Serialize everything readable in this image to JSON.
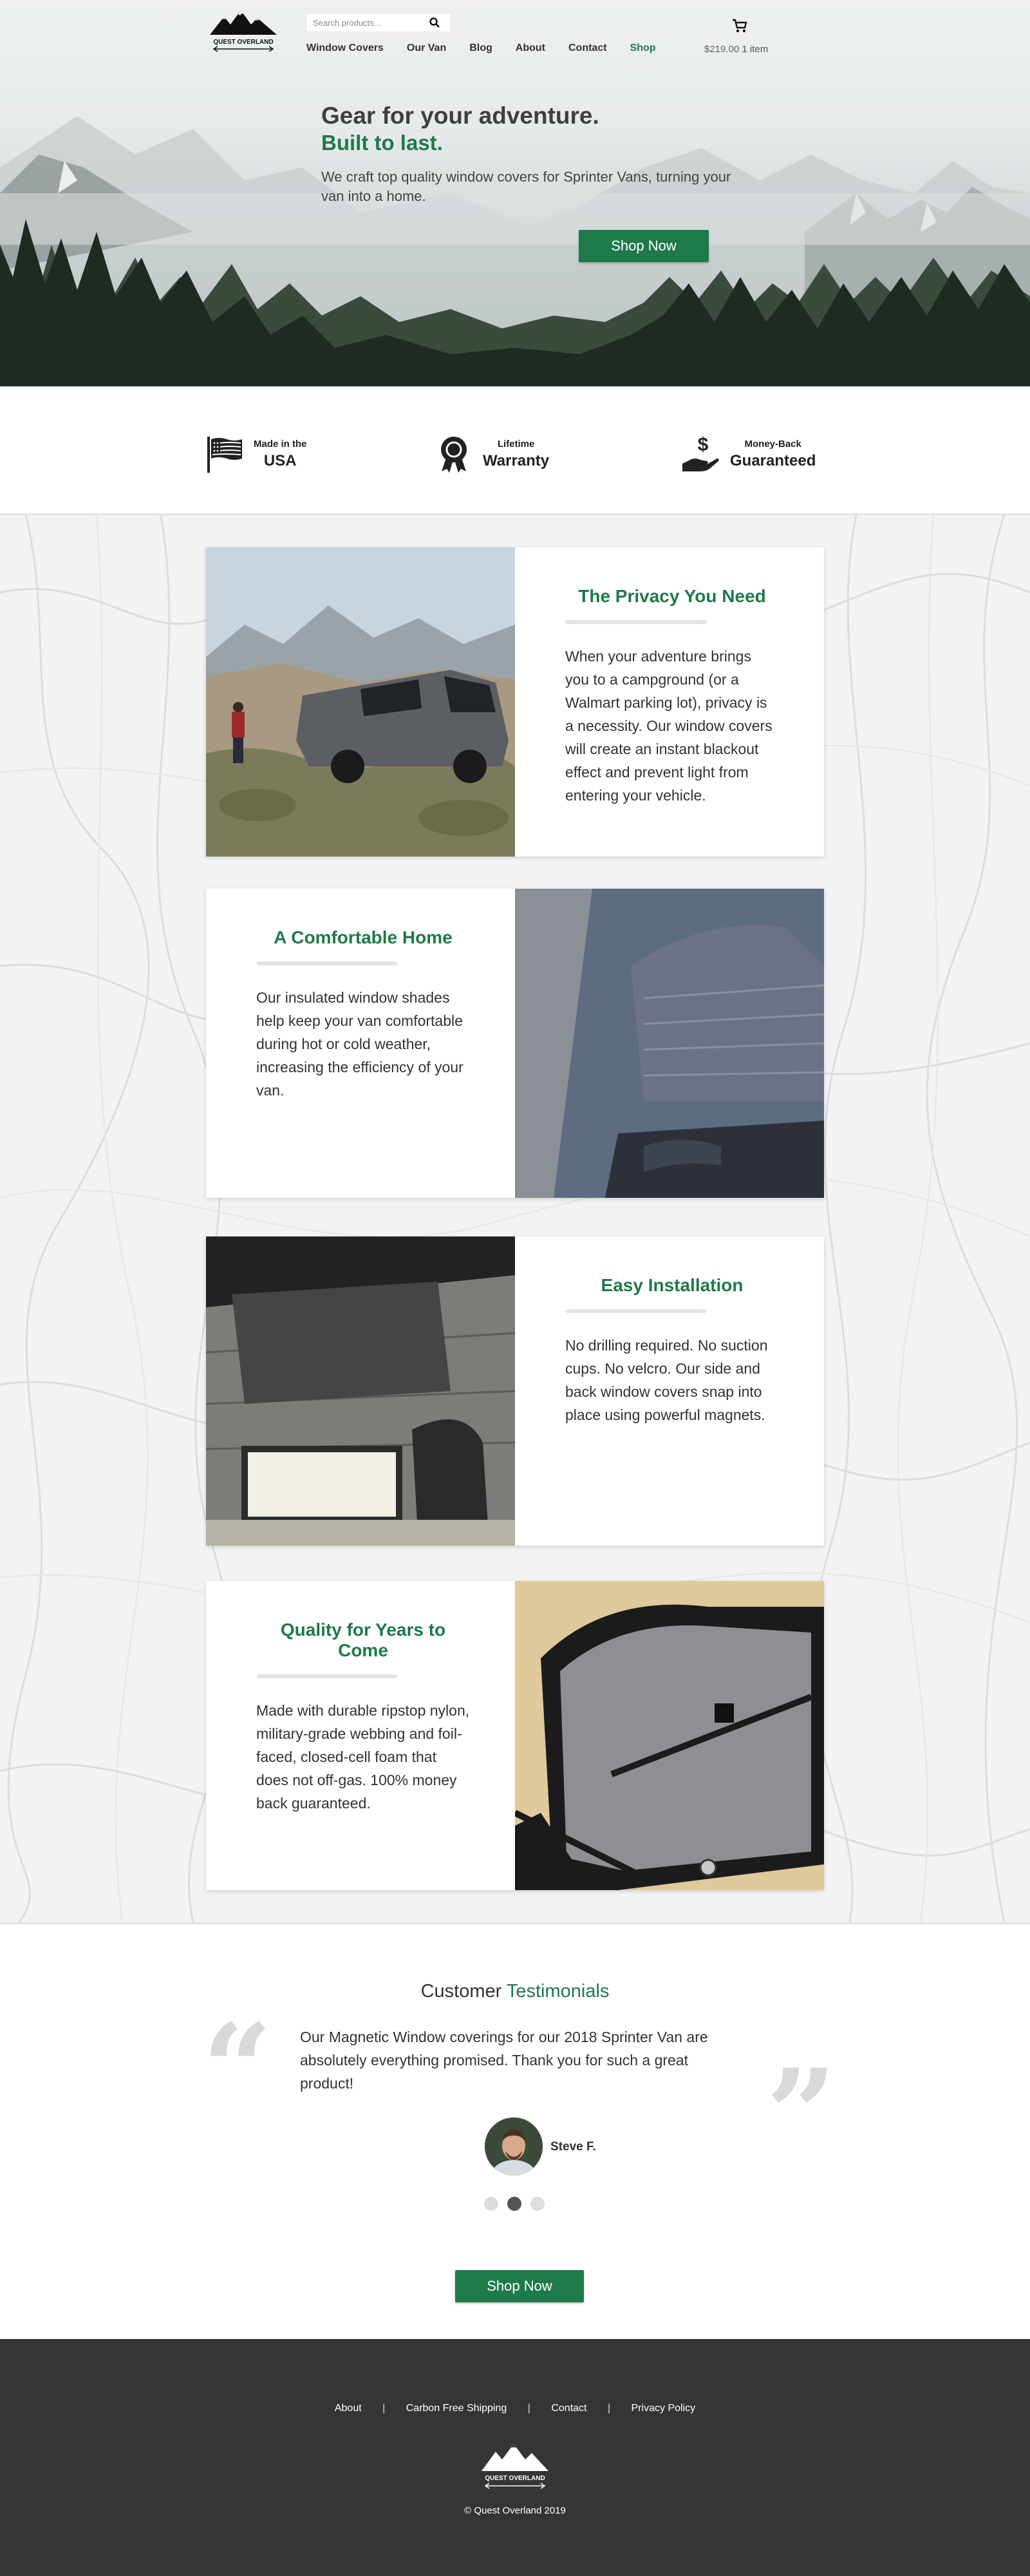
{
  "header": {
    "logo_text": "QUEST OVERLAND",
    "search": {
      "placeholder": "Search products..."
    },
    "nav": [
      {
        "label": "Window Covers"
      },
      {
        "label": "Our Van"
      },
      {
        "label": "Blog"
      },
      {
        "label": "About"
      },
      {
        "label": "Contact"
      },
      {
        "label": "Shop",
        "active": true
      }
    ],
    "cart": {
      "total": "$219.00",
      "count": "1 item"
    }
  },
  "hero": {
    "title": "Gear for your adventure.",
    "subtitle": "Built to last.",
    "text": "We craft top quality window covers for Sprinter Vans, turning your van into a home.",
    "button": "Shop Now"
  },
  "badges": [
    {
      "icon": "usa-flag-icon",
      "small": "Made in the",
      "big": "USA"
    },
    {
      "icon": "award-ribbon-icon",
      "small": "Lifetime",
      "big": "Warranty"
    },
    {
      "icon": "money-back-hand-icon",
      "small": "Money-Back",
      "big": "Guaranteed"
    }
  ],
  "features": [
    {
      "title": "The Privacy You Need",
      "text": "When your adventure brings you to a campground (or a Walmart parking lot), privacy is a necessity. Our window covers will create an instant blackout effect and prevent light from entering your vehicle."
    },
    {
      "title": "A Comfortable Home",
      "text": "Our insulated window shades help keep your van comfortable during hot or cold weather, increasing the efficiency of your van."
    },
    {
      "title": "Easy Installation",
      "text": "No drilling required. No suction cups. No velcro. Our side and back window covers snap into place using powerful magnets."
    },
    {
      "title": "Quality for Years to Come",
      "text": "Made with durable ripstop nylon, military-grade webbing and foil-faced, closed-cell foam that does not off-gas. 100% money back guaranteed."
    }
  ],
  "testimonials": {
    "heading_prefix": "Customer",
    "heading_accent": "Testimonials",
    "quote": "Our Magnetic Window coverings for our 2018 Sprinter Van are absolutely everything promised. Thank you for such a great product!",
    "author": "Steve F.",
    "active_slide": 2,
    "slide_count": 3,
    "button": "Shop Now"
  },
  "footer": {
    "links": [
      "About",
      "Carbon Free Shipping",
      "Contact",
      "Privacy Policy"
    ],
    "separator": "|",
    "logo_text": "QUEST OVERLAND",
    "copyright": "© Quest Overland 2019"
  },
  "colors": {
    "accent": "#1f7a4a",
    "footer_bg": "#353535",
    "text": "#333333"
  }
}
